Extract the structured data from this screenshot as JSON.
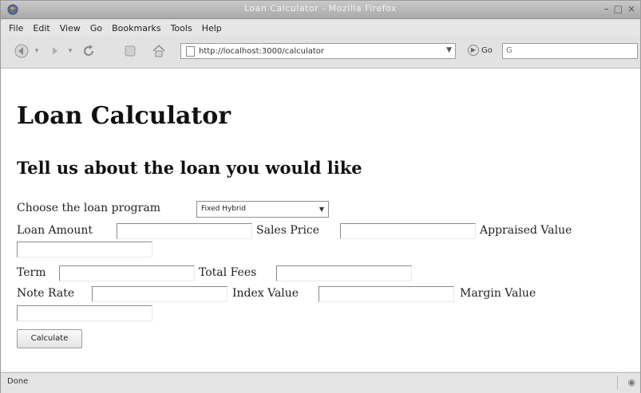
{
  "window": {
    "title": "Loan Calculator - Mozilla Firefox",
    "controls": [
      "–",
      "□",
      "×"
    ]
  },
  "menu": [
    "File",
    "Edit",
    "View",
    "Go",
    "Bookmarks",
    "Tools",
    "Help"
  ],
  "navbar": {
    "url": "http://localhost:3000/calculator",
    "go_label": "Go",
    "search_value": "G"
  },
  "page": {
    "title": "Loan Calculator",
    "subtitle": "Tell us about the loan you would like",
    "program_label": "Choose the loan program",
    "program_selected": "Fixed Hybrid",
    "fields": {
      "loan_amount": "Loan Amount",
      "sales_price": "Sales Price",
      "appraised_value": "Appraised Value",
      "term": "Term",
      "total_fees": "Total Fees",
      "note_rate": "Note Rate",
      "index_value": "Index Value",
      "margin_value": "Margin Value"
    },
    "calculate_label": "Calculate"
  },
  "status": {
    "text": "Done"
  }
}
